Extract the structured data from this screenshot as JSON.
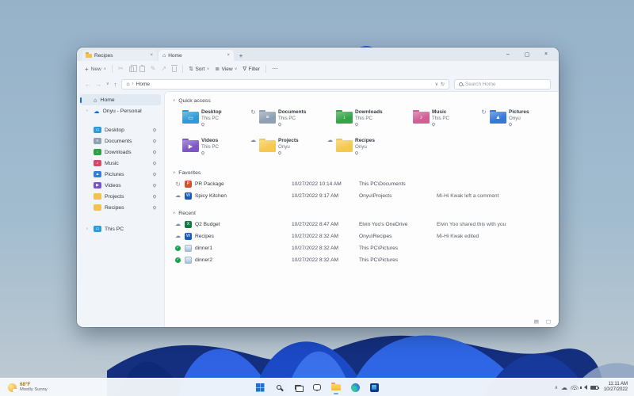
{
  "icons": {
    "plus": "+",
    "chevron": "∨",
    "caret_right": "›",
    "home": "⌂",
    "back": "←",
    "forward": "→",
    "up": "↑",
    "refresh": "↻",
    "cut": "✂",
    "rename": "✎",
    "share": "↗",
    "sort": "⇅",
    "view": "≣",
    "filter": "∇",
    "more": "⋯",
    "minimize": "–",
    "maximize": "▢",
    "close": "×",
    "cloud": "☁",
    "tray_chevron": "∧",
    "details_view": "▤",
    "icon_view": "▢",
    "section_chevron": "∨"
  },
  "window": {
    "tabs": [
      {
        "label": "Recipes"
      },
      {
        "label": "Home"
      }
    ],
    "toolbar": {
      "new": "New",
      "sort": "Sort",
      "view": "View",
      "filter": "Filter"
    },
    "address": {
      "breadcrumb": "Home",
      "search_placeholder": "Search Home"
    },
    "sidebar": {
      "home": "Home",
      "onedrive": "Onyu - Personal",
      "this_pc": "This PC",
      "this_pc_icon": {
        "color": "#2e9bd6",
        "glyph": "▭"
      },
      "pinned": [
        {
          "label": "Desktop",
          "color": "#2e9bd6",
          "glyph": "▭"
        },
        {
          "label": "Documents",
          "color": "#8fa0b4",
          "glyph": "≡"
        },
        {
          "label": "Downloads",
          "color": "#2f9e44",
          "glyph": "↓"
        },
        {
          "label": "Music",
          "color": "#d9466b",
          "glyph": "♪"
        },
        {
          "label": "Pictures",
          "color": "#2f7fd6",
          "glyph": "▲"
        },
        {
          "label": "Videos",
          "color": "#7a52c7",
          "glyph": "▶"
        },
        {
          "label": "Projects",
          "color": "#f2c14e",
          "glyph": ""
        },
        {
          "label": "Recipes",
          "color": "#f2c14e",
          "glyph": ""
        }
      ]
    },
    "quick_access": {
      "title": "Quick access",
      "tiles": [
        {
          "name": "Desktop",
          "location": "This PC",
          "color": "#2e9bd6",
          "glyph": "▭",
          "status": ""
        },
        {
          "name": "Documents",
          "location": "This PC",
          "color": "#8fa0b4",
          "glyph": "≡",
          "status": "sync"
        },
        {
          "name": "Downloads",
          "location": "This PC",
          "color": "#35a447",
          "glyph": "↓",
          "status": ""
        },
        {
          "name": "Music",
          "location": "This PC",
          "color": "#cf5f94",
          "glyph": "♪",
          "status": ""
        },
        {
          "name": "Pictures",
          "location": "Onyu",
          "color": "#3579d8",
          "glyph": "▲",
          "status": "sync"
        },
        {
          "name": "Videos",
          "location": "This PC",
          "color": "#7e57c5",
          "glyph": "▶",
          "status": ""
        },
        {
          "name": "Projects",
          "location": "Onyu",
          "color": "#f5c84f",
          "glyph": "",
          "status": "cloud"
        },
        {
          "name": "Recipes",
          "location": "Onyu",
          "color": "#f5c84f",
          "glyph": "",
          "status": "cloud"
        }
      ]
    },
    "favorites": {
      "title": "Favorites",
      "rows": [
        {
          "name": "PR Package",
          "app": "powerpoint",
          "app_letter": "P",
          "status": "sync",
          "date": "10/27/2022 10:14 AM",
          "location": "This PC\\Documents",
          "note": ""
        },
        {
          "name": "Spicy Kitchen",
          "app": "word",
          "app_letter": "W",
          "status": "cloud",
          "date": "10/27/2022 9:17 AM",
          "location": "Onyu\\Projects",
          "note": "Mi-Hi Kwak left a comment"
        }
      ]
    },
    "recent": {
      "title": "Recent",
      "rows": [
        {
          "name": "Q2 Budget",
          "app": "excel",
          "app_letter": "X",
          "status": "cloud",
          "date": "10/27/2022 8:47 AM",
          "location": "Elvin Yoo's OneDrive",
          "note": "Elvin Yoo shared this with you"
        },
        {
          "name": "Recipes",
          "app": "word",
          "app_letter": "W",
          "status": "cloud",
          "date": "10/27/2022 8:32 AM",
          "location": "Onyu\\Recipes",
          "note": "Mi-Hi Kwak edited"
        },
        {
          "name": "dinner1",
          "app": "image",
          "app_letter": "",
          "status": "check",
          "date": "10/27/2022 8:32 AM",
          "location": "This PC\\Pictures",
          "note": ""
        },
        {
          "name": "dinner2",
          "app": "image",
          "app_letter": "",
          "status": "check",
          "date": "10/27/2022 8:32 AM",
          "location": "This PC\\Pictures",
          "note": ""
        }
      ]
    }
  },
  "taskbar": {
    "weather": {
      "temp": "68°F",
      "condition": "Mostly Sunny"
    },
    "tray": {
      "time": "11:11 AM",
      "date": "10/27/2022"
    }
  }
}
